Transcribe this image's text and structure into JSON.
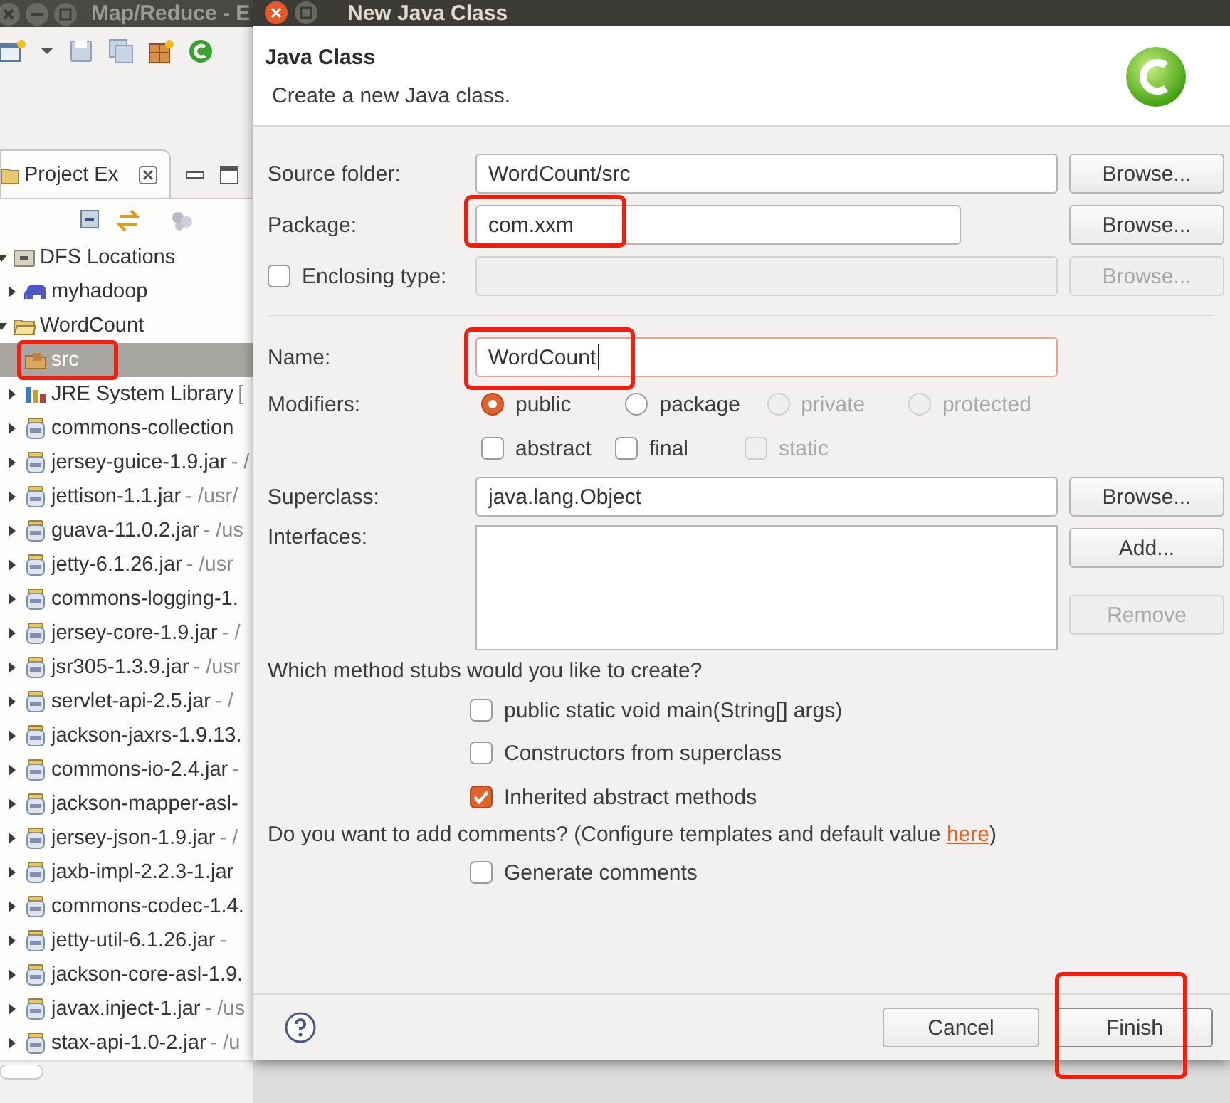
{
  "ide": {
    "title": "Map/Reduce - E",
    "view_tab": {
      "label": "Project Ex",
      "selected": true
    }
  },
  "tree": [
    {
      "kind": "server-folder",
      "label": "DFS Locations",
      "expanded": true,
      "selected": false,
      "children": [
        {
          "kind": "elephant",
          "label": "myhadoop",
          "expanded": false,
          "selected": false
        }
      ]
    },
    {
      "kind": "project",
      "label": "WordCount",
      "expanded": true,
      "selected": false,
      "children": [
        {
          "kind": "package-folder",
          "label": "src",
          "selected": true,
          "highlighted": true
        },
        {
          "kind": "library",
          "label": "JRE System Library",
          "detail": " [",
          "expanded": false,
          "selected": false
        },
        {
          "kind": "jar",
          "label": "commons-collection",
          "expanded": false,
          "selected": false
        },
        {
          "kind": "jar",
          "label": "jersey-guice-1.9.jar",
          "detail": " - /",
          "expanded": false,
          "selected": false
        },
        {
          "kind": "jar",
          "label": "jettison-1.1.jar",
          "detail": " - /usr/",
          "expanded": false,
          "selected": false
        },
        {
          "kind": "jar",
          "label": "guava-11.0.2.jar",
          "detail": " - /us",
          "expanded": false,
          "selected": false
        },
        {
          "kind": "jar",
          "label": "jetty-6.1.26.jar",
          "detail": " - /usr",
          "expanded": false,
          "selected": false
        },
        {
          "kind": "jar",
          "label": "commons-logging-1.",
          "expanded": false,
          "selected": false
        },
        {
          "kind": "jar",
          "label": "jersey-core-1.9.jar",
          "detail": " - /",
          "expanded": false,
          "selected": false
        },
        {
          "kind": "jar",
          "label": "jsr305-1.3.9.jar",
          "detail": " - /usr",
          "expanded": false,
          "selected": false
        },
        {
          "kind": "jar",
          "label": "servlet-api-2.5.jar",
          "detail": " - /",
          "expanded": false,
          "selected": false
        },
        {
          "kind": "jar",
          "label": "jackson-jaxrs-1.9.13.",
          "expanded": false,
          "selected": false
        },
        {
          "kind": "jar",
          "label": "commons-io-2.4.jar",
          "detail": " -",
          "expanded": false,
          "selected": false
        },
        {
          "kind": "jar",
          "label": "jackson-mapper-asl-",
          "expanded": false,
          "selected": false
        },
        {
          "kind": "jar",
          "label": "jersey-json-1.9.jar",
          "detail": " - /",
          "expanded": false,
          "selected": false
        },
        {
          "kind": "jar",
          "label": "jaxb-impl-2.2.3-1.jar",
          "expanded": false,
          "selected": false
        },
        {
          "kind": "jar",
          "label": "commons-codec-1.4.",
          "expanded": false,
          "selected": false
        },
        {
          "kind": "jar",
          "label": "jetty-util-6.1.26.jar",
          "detail": " -",
          "expanded": false,
          "selected": false
        },
        {
          "kind": "jar",
          "label": "jackson-core-asl-1.9.",
          "expanded": false,
          "selected": false
        },
        {
          "kind": "jar",
          "label": "javax.inject-1.jar",
          "detail": " - /us",
          "expanded": false,
          "selected": false
        },
        {
          "kind": "jar",
          "label": "stax-api-1.0-2.jar",
          "detail": " - /u",
          "expanded": false,
          "selected": false
        }
      ]
    }
  ],
  "dialog": {
    "title": "New Java Class",
    "heading": "Java Class",
    "description": "Create a new Java class.",
    "source_folder": {
      "label": "Source folder:",
      "value": "WordCount/src",
      "button": {
        "label": "Browse...",
        "disabled": false
      }
    },
    "package": {
      "label": "Package:",
      "value": "com.xxm",
      "highlighted": true,
      "button": {
        "label": "Browse...",
        "disabled": false
      }
    },
    "enclosing_type": {
      "label": "Enclosing type:",
      "checked": false,
      "disabled": true,
      "button": {
        "label": "Browse...",
        "disabled": true
      }
    },
    "name": {
      "label": "Name:",
      "value": "WordCount",
      "focused": true,
      "highlighted": true
    },
    "modifiers": {
      "label": "Modifiers:",
      "radios": [
        {
          "label": "public",
          "selected": true,
          "disabled": false
        },
        {
          "label": "package",
          "selected": false,
          "disabled": false
        },
        {
          "label": "private",
          "selected": false,
          "disabled": true
        },
        {
          "label": "protected",
          "selected": false,
          "disabled": true
        }
      ],
      "checks": [
        {
          "label": "abstract",
          "checked": false,
          "disabled": false
        },
        {
          "label": "final",
          "checked": false,
          "disabled": false
        },
        {
          "label": "static",
          "checked": false,
          "disabled": true
        }
      ]
    },
    "superclass": {
      "label": "Superclass:",
      "value": "java.lang.Object",
      "button": {
        "label": "Browse...",
        "disabled": false
      }
    },
    "interfaces": {
      "label": "Interfaces:",
      "buttons": [
        {
          "label": "Add...",
          "disabled": false
        },
        {
          "label": "Remove",
          "disabled": true
        }
      ]
    },
    "stubs": {
      "question": "Which method stubs would you like to create?",
      "options": [
        {
          "label": "public static void main(String[] args)",
          "checked": false
        },
        {
          "label": "Constructors from superclass",
          "checked": false
        },
        {
          "label": "Inherited abstract methods",
          "checked": true
        }
      ]
    },
    "comments": {
      "question": "Do you want to add comments? (Configure templates and default value ",
      "link": "here",
      "question_end": ")",
      "options": [
        {
          "label": "Generate comments",
          "checked": false
        }
      ]
    },
    "buttons": [
      {
        "label": "Cancel",
        "default": false,
        "highlighted": false
      },
      {
        "label": "Finish",
        "default": true,
        "highlighted": true
      }
    ]
  }
}
